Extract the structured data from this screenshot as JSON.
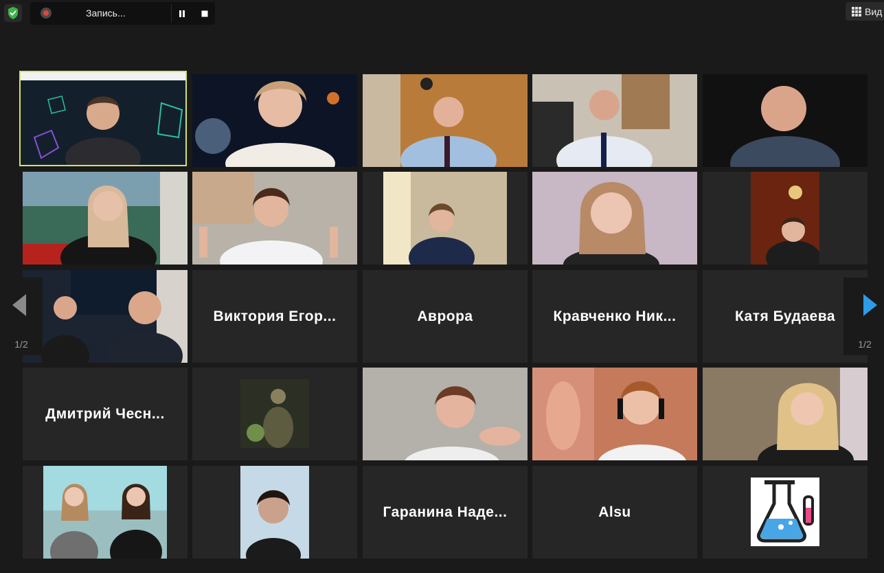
{
  "recording": {
    "label": "Запись..."
  },
  "view": {
    "label": "Вид"
  },
  "pagination": {
    "left": "1/2",
    "right": "1/2"
  },
  "tiles": [
    {
      "id": "t1",
      "type": "video",
      "active": true,
      "bg": "#13202c"
    },
    {
      "id": "t2",
      "type": "video",
      "bg": "#0d1426"
    },
    {
      "id": "t3",
      "type": "video",
      "bg": "#b97b3a"
    },
    {
      "id": "t4",
      "type": "video",
      "bg": "#c9c1b4"
    },
    {
      "id": "t5",
      "type": "video",
      "bg": "#111111"
    },
    {
      "id": "t6",
      "type": "video",
      "bg": "#3a6a58"
    },
    {
      "id": "t7",
      "type": "video",
      "bg": "#b8b2a8"
    },
    {
      "id": "t8",
      "type": "video",
      "bg": "#c9b99d"
    },
    {
      "id": "t9",
      "type": "video",
      "bg": "#c8b7c4"
    },
    {
      "id": "t10",
      "type": "video",
      "bg": "#6a2410"
    },
    {
      "id": "t11",
      "type": "video",
      "bg": "#1c2331"
    },
    {
      "id": "t12",
      "type": "name",
      "name": "Виктория Егор..."
    },
    {
      "id": "t13",
      "type": "name",
      "name": "Аврора"
    },
    {
      "id": "t14",
      "type": "name",
      "name": "Кравченко Ник..."
    },
    {
      "id": "t15",
      "type": "name",
      "name": "Катя Будаева"
    },
    {
      "id": "t16",
      "type": "name",
      "name": "Дмитрий Чесн..."
    },
    {
      "id": "t17",
      "type": "video",
      "bg": "#353a2c"
    },
    {
      "id": "t18",
      "type": "video",
      "bg": "#b4b0aa"
    },
    {
      "id": "t19",
      "type": "video",
      "bg": "#c57a5c"
    },
    {
      "id": "t20",
      "type": "video",
      "bg": "#8a7a63"
    },
    {
      "id": "t21",
      "type": "video",
      "bg": "#9bbfc0"
    },
    {
      "id": "t22",
      "type": "video",
      "bg": "#c6d9e6"
    },
    {
      "id": "t23",
      "type": "name",
      "name": "Гаранина Наде..."
    },
    {
      "id": "t24",
      "type": "name",
      "name": "Alsu"
    },
    {
      "id": "t25",
      "type": "avatar",
      "bg": "#ffffff"
    }
  ]
}
